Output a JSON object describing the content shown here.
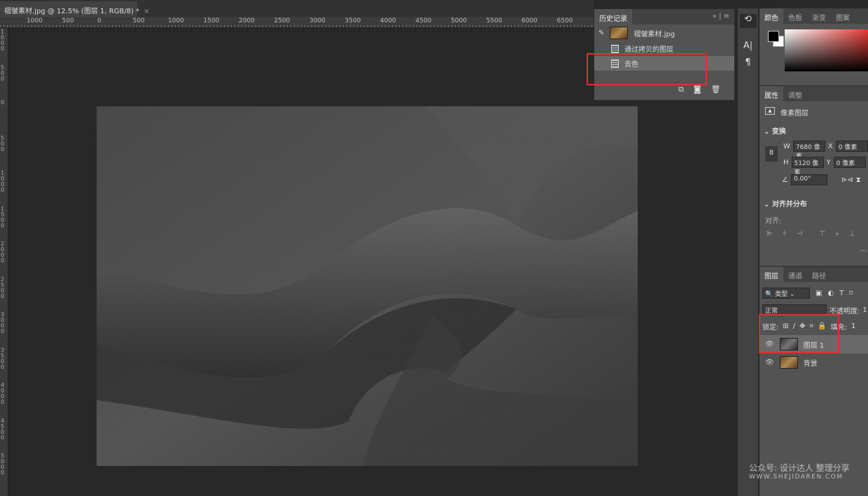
{
  "document_tab": {
    "title": "褶皱素材.jpg @ 12.5% (图层 1, RGB/8) *",
    "close": "×"
  },
  "rulers": {
    "horizontal": [
      "1000",
      "500",
      "0",
      "500",
      "1000",
      "1500",
      "2000",
      "2500",
      "3000",
      "3500",
      "4000",
      "4500",
      "5000",
      "5500",
      "6000",
      "6500"
    ],
    "vertical": [
      "1000",
      "500",
      "0",
      "500",
      "1000",
      "1500",
      "2000",
      "2500",
      "3000",
      "3500",
      "4000",
      "4500",
      "5000"
    ]
  },
  "history": {
    "tab": "历史记录",
    "menu_icons": "» | ≡",
    "snapshot": "褶皱素材.jpg",
    "items": [
      {
        "label": "通过拷贝的图层"
      },
      {
        "label": "去色",
        "selected": true
      }
    ]
  },
  "tools": [
    "history-brush-icon",
    "character-icon",
    "paragraph-icon"
  ],
  "color_panel": {
    "tabs": [
      "颜色",
      "色板",
      "渐变",
      "图案"
    ],
    "foreground": "#000000",
    "background": "#ffffff",
    "accent": "#e53935"
  },
  "properties": {
    "tabs": [
      "属性",
      "调整"
    ],
    "layer_type": "像素图层",
    "transform_title": "变换",
    "w_label": "W",
    "w": "7680 像素",
    "x_label": "X",
    "x": "0 像素",
    "h_label": "H",
    "h": "5120 像素",
    "y_label": "Y",
    "y": "0 像素",
    "angle": "0.00°",
    "align_title": "对齐并分布",
    "align_label": "对齐:",
    "more": "..."
  },
  "layers": {
    "tabs": [
      "图层",
      "通道",
      "路径"
    ],
    "filter": "类型",
    "blend_mode": "正常",
    "opacity_label": "不透明度:",
    "opacity": "1",
    "lock_label": "锁定:",
    "fill_label": "填充:",
    "fill": "1",
    "items": [
      {
        "name": "图层 1",
        "selected": true
      },
      {
        "name": "背景"
      }
    ]
  },
  "watermark": {
    "line1": "公众号: 设计达人 整理分享",
    "line2": "WWW.SHEJIDAREN.COM"
  },
  "highlight_color": "#e0302a"
}
